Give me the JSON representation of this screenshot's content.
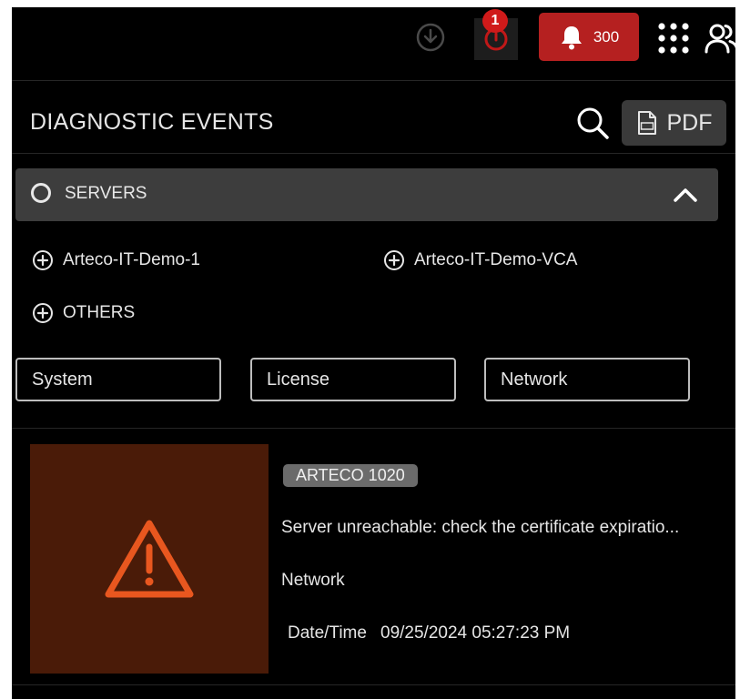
{
  "topbar": {
    "alarm_badge": "1",
    "notification_count": "300",
    "colors": {
      "notification_bg": "#b52020",
      "badge_bg": "#d01a1a"
    },
    "icons": [
      "download-icon",
      "alarm-icon",
      "bell-icon",
      "apps-grid-icon",
      "users-icon"
    ]
  },
  "header": {
    "title": "DIAGNOSTIC EVENTS",
    "pdf_label": "PDF"
  },
  "servers": {
    "label": "SERVERS",
    "items": [
      {
        "label": "Arteco-IT-Demo-1"
      },
      {
        "label": "Arteco-IT-Demo-VCA"
      },
      {
        "label": "OTHERS"
      }
    ]
  },
  "filters": [
    {
      "label": "System"
    },
    {
      "label": "License"
    },
    {
      "label": "Network"
    }
  ],
  "event": {
    "tag": "ARTECO 1020",
    "message": "Server unreachable: check the certificate expiratio...",
    "category": "Network",
    "date_label": "Date/Time",
    "date_value": "09/25/2024 05:27:23 PM",
    "thumb_color": "#4a1b08",
    "warning_color": "#e8571f"
  }
}
